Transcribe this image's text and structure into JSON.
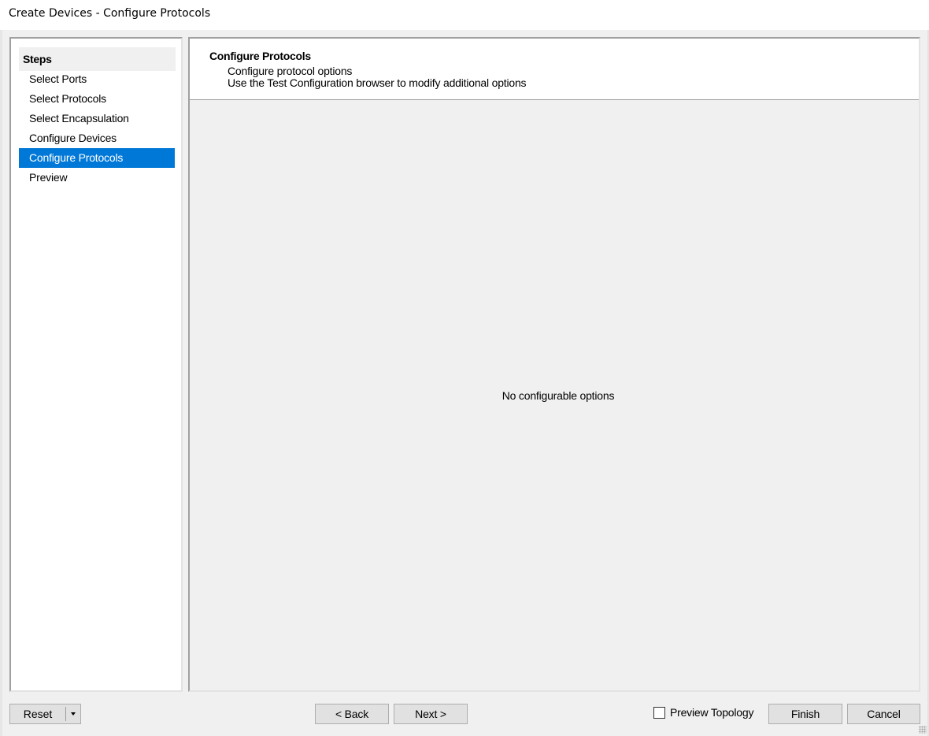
{
  "window": {
    "title": "Create Devices - Configure Protocols"
  },
  "steps": {
    "header": "Steps",
    "items": [
      {
        "label": "Select Ports",
        "active": false
      },
      {
        "label": "Select Protocols",
        "active": false
      },
      {
        "label": "Select Encapsulation",
        "active": false
      },
      {
        "label": "Configure Devices",
        "active": false
      },
      {
        "label": "Configure Protocols",
        "active": true
      },
      {
        "label": "Preview",
        "active": false
      }
    ]
  },
  "content": {
    "title": "Configure Protocols",
    "line1": "Configure protocol options",
    "line2": "Use the Test Configuration browser to modify additional options",
    "empty_message": "No configurable options"
  },
  "footer": {
    "reset_label": "Reset",
    "back_label": "< Back",
    "next_label": "Next >",
    "preview_topology_label": "Preview Topology",
    "preview_topology_checked": false,
    "finish_label": "Finish",
    "cancel_label": "Cancel"
  },
  "colors": {
    "selection": "#0078d7",
    "background": "#f0f0f0",
    "panel": "#ffffff"
  }
}
